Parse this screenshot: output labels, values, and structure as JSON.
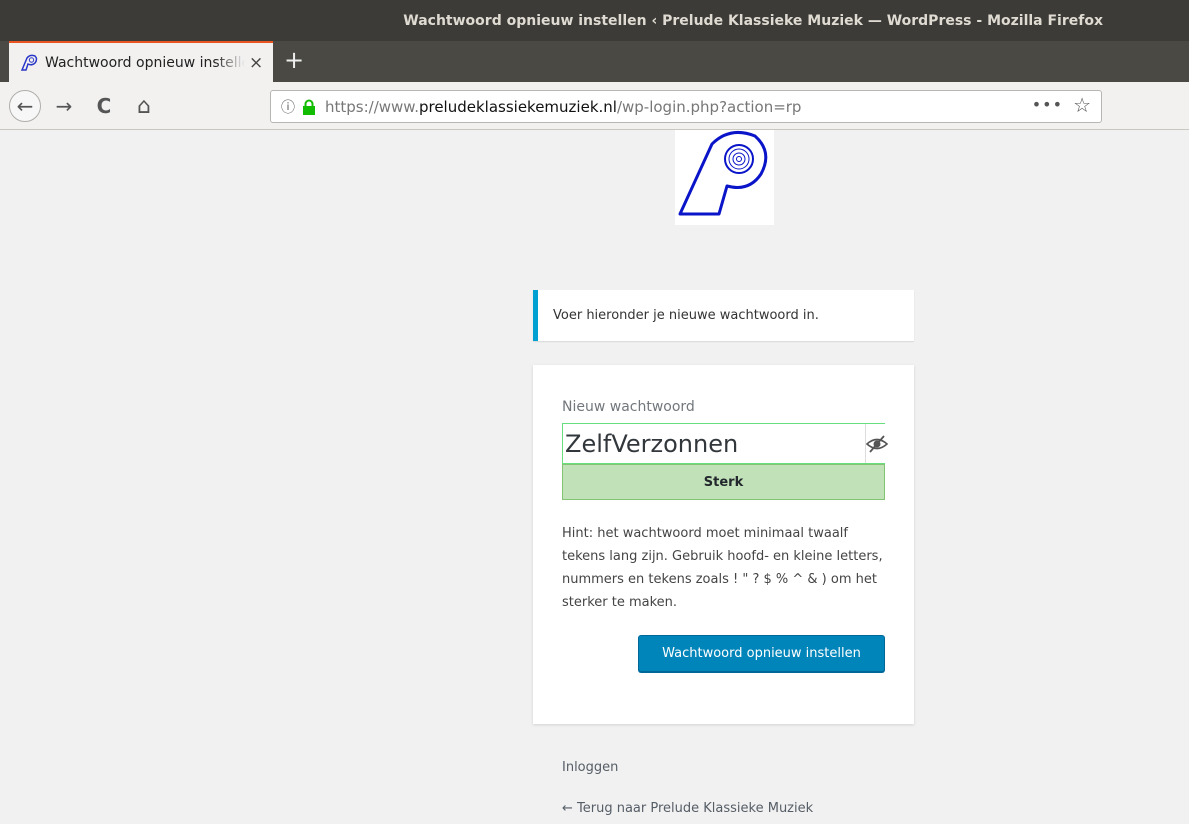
{
  "window": {
    "title": "Wachtwoord opnieuw instellen ‹ Prelude Klassieke Muziek — WordPress - Mozilla Firefox"
  },
  "tabs": [
    {
      "label": "Wachtwoord opnieuw instellen ‹ Prelude Klassieke Muziek",
      "icon": "site-favicon-icon",
      "close": "×"
    }
  ],
  "newtab_label": "+",
  "nav": {
    "back_icon": "←",
    "forward_icon": "→",
    "reload_icon": "C",
    "home_icon": "⌂",
    "url_prefix": "https://www.",
    "url_domain": "preludeklassiekemuziek.nl",
    "url_path": "/wp-login.php?action=rp",
    "info_icon": "ⓘ",
    "more_label": "•••",
    "star_icon": "☆"
  },
  "notice": {
    "message": "Voer hieronder je nieuwe wachtwoord in."
  },
  "form": {
    "password_label": "Nieuw wachtwoord",
    "password_value": "ZelfVerzonnen",
    "strength_label": "Sterk",
    "hint": "Hint: het wachtwoord moet minimaal twaalf tekens lang zijn. Gebruik hoofd- en kleine letters, nummers en tekens zoals ! \" ? $ % ^ & ) om het sterker te maken.",
    "submit_label": "Wachtwoord opnieuw instellen"
  },
  "footer": {
    "login_link": "Inloggen",
    "back_link": "← Terug naar Prelude Klassieke Muziek"
  },
  "colors": {
    "accent_orange": "#e95420",
    "notice_border": "#00a0d2",
    "primary_button": "#0085ba",
    "strength_strong": "#c1e1b9",
    "logo_blue": "#0a14c8"
  }
}
